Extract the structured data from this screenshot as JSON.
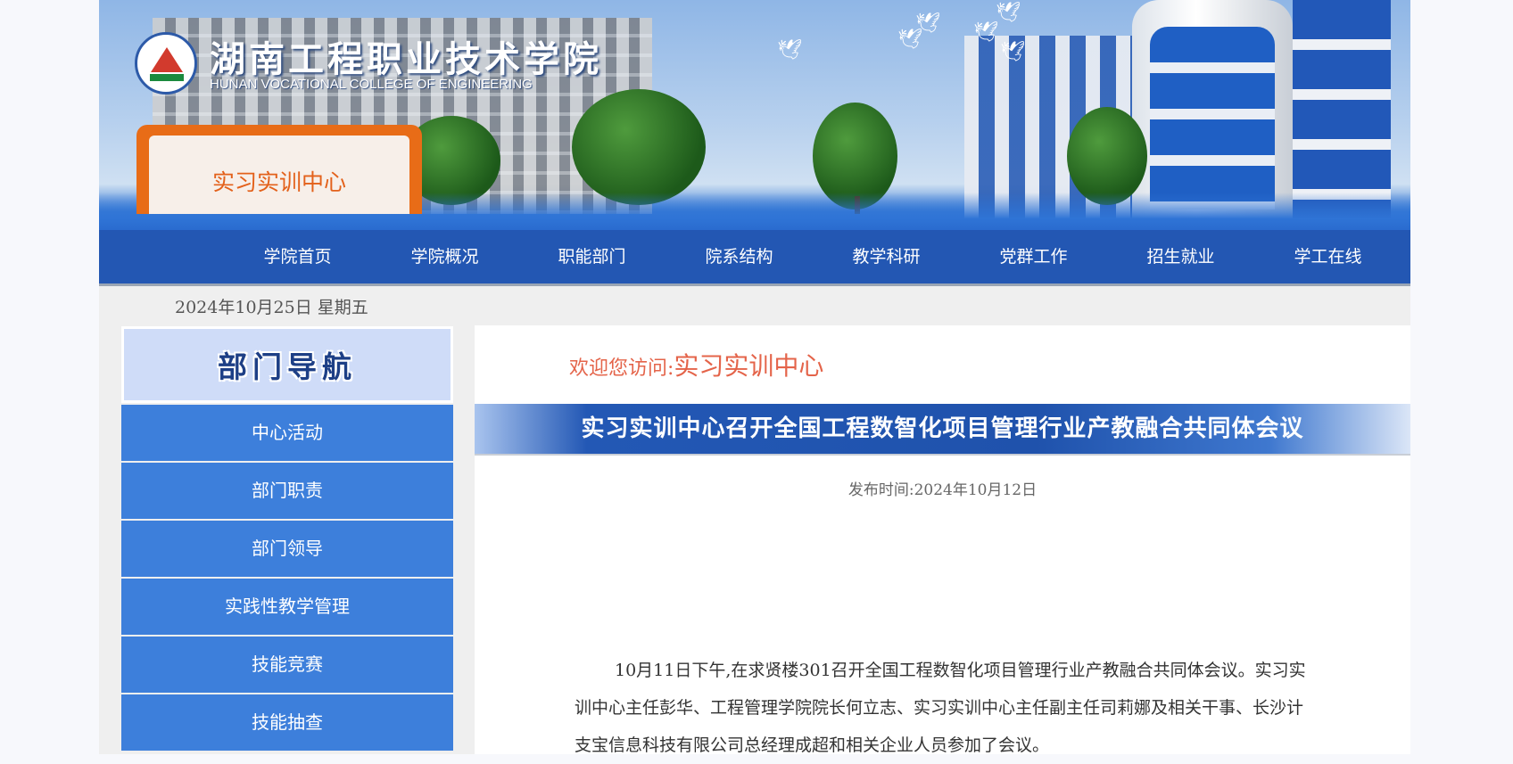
{
  "banner": {
    "school_name_cn": "湖南工程职业技术学院",
    "school_name_en": "HUNAN VOCATIONAL COLLEGE OF ENGINEERING",
    "department": "实习实训中心"
  },
  "nav": {
    "items": [
      "学院首页",
      "学院概况",
      "职能部门",
      "院系结构",
      "教学科研",
      "党群工作",
      "招生就业",
      "学工在线"
    ]
  },
  "date_line": "2024年10月25日  星期五",
  "sidebar": {
    "heading": "部门导航",
    "items": [
      "中心活动",
      "部门职责",
      "部门领导",
      "实践性教学管理",
      "技能竞赛",
      "技能抽查"
    ]
  },
  "content": {
    "welcome_label": "欢迎您访问:",
    "welcome_name": "实习实训中心",
    "article_title": "实习实训中心召开全国工程数智化项目管理行业产教融合共同体会议",
    "publish_time": "发布时间:2024年10月12日",
    "paragraph": "10月11日下午,在求贤楼301召开全国工程数智化项目管理行业产教融合共同体会议。实习实训中心主任彭华、工程管理学院院长何立志、实习实训中心主任副主任司莉娜及相关干事、长沙计支宝信息科技有限公司总经理成超和相关企业人员参加了会议。"
  },
  "colors": {
    "nav_bg": "#2357b3",
    "sidebar_item_bg": "#3d7fdb",
    "accent_orange": "#e4644a"
  }
}
